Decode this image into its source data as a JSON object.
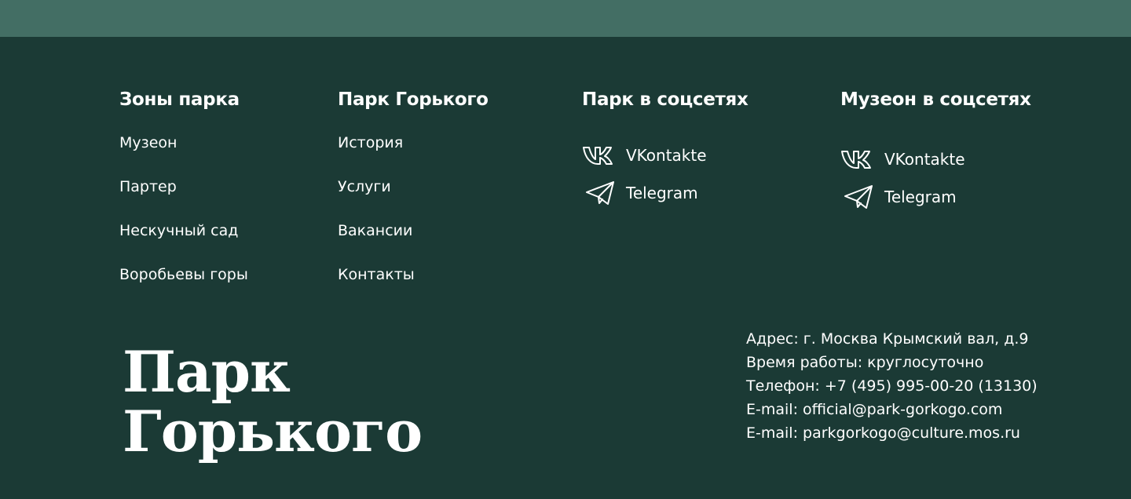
{
  "footer": {
    "zones": {
      "title": "Зоны парка",
      "items": [
        "Музеон",
        "Партер",
        "Нескучный сад",
        "Воробьевы горы"
      ]
    },
    "park": {
      "title": "Парк Горького",
      "items": [
        "История",
        "Услуги",
        "Вакансии",
        "Контакты"
      ]
    },
    "park_social": {
      "title": "Парк в соцсетях",
      "vk": {
        "label": "VKontakte",
        "icon": "vk-icon"
      },
      "tg": {
        "label": "Telegram",
        "icon": "telegram-icon"
      }
    },
    "museon_social": {
      "title": "Музеон в соцсетях",
      "vk": {
        "label": "VKontakte",
        "icon": "vk-icon"
      },
      "tg": {
        "label": "Telegram",
        "icon": "telegram-icon"
      }
    },
    "logo": {
      "line1": "Парк",
      "line2": "Горького"
    },
    "contacts": {
      "address": "Адрес: г. Москва Крымский вал, д.9",
      "hours": "Время работы: круглосуточно",
      "phone": "Телефон: +7 (495) 995-00-20 (13130)",
      "email1": "E-mail: official@park-gorkogo.com",
      "email2": "E-mail: parkgorkogo@culture.mos.ru"
    },
    "colors": {
      "background": "#1b3a35",
      "top_strip": "#436e64",
      "text": "#ffffff"
    }
  }
}
